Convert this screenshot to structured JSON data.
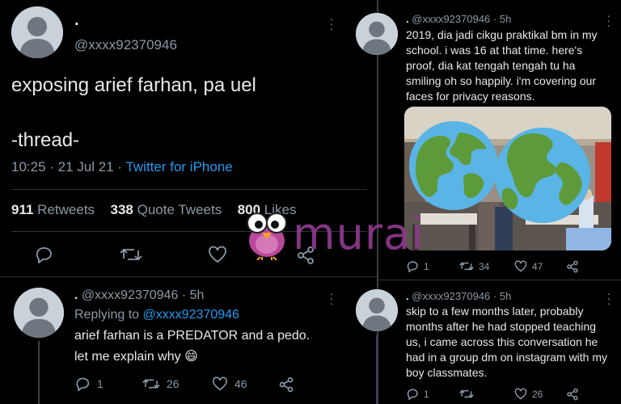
{
  "main_tweet": {
    "display_name": ".",
    "handle": "@xxxx92370946",
    "text_line1": "exposing arief farhan, pa uel",
    "text_line2": "-thread-",
    "time": "10:25 · 21 Jul 21 · ",
    "client": "Twitter for iPhone",
    "retweets_count": "911",
    "retweets_label": "Retweets",
    "quotes_count": "338",
    "quotes_label": "Quote Tweets",
    "likes_count": "800",
    "likes_label": "Likes"
  },
  "reply_tweet": {
    "display_name": ".",
    "handle": "@xxxx92370946",
    "age": "· 5h",
    "replying_prefix": "Replying to ",
    "replying_handle": "@xxxx92370946",
    "line1": "arief farhan is a PREDATOR and a pedo.",
    "line2": "let me explain why 😄",
    "replies": "1",
    "retweets": "26",
    "likes": "46"
  },
  "right_tweet_1": {
    "display_name": ".",
    "handle": "@xxxx92370946",
    "age": "· 5h",
    "line1": "2019, dia jadi cikgu praktikal bm in my",
    "line2": "school. i was 16 at that time. here's",
    "line3": "proof, dia kat tengah tengah tu ha",
    "line4": "smiling oh so happily. i'm covering our",
    "line5": "faces for privacy reasons.",
    "replies": "1",
    "retweets": "34",
    "likes": "47"
  },
  "right_tweet_2": {
    "display_name": ".",
    "handle": "@xxxx92370946",
    "age": "· 5h",
    "line1": "skip to a few months later, probably",
    "line2": "months after he had stopped teaching",
    "line3": "us, i came across this conversation he",
    "line4": "had in a group dm on instagram with my",
    "line5": "boy classmates.",
    "replies": "1",
    "likes": "26"
  },
  "watermark": {
    "brand": "murai",
    "color": "#8e3a8f"
  },
  "colors": {
    "background": "#000000",
    "link_blue": "#1d9bf0",
    "secondary_gray": "#8b98a5"
  },
  "icons": [
    "reply-icon",
    "retweet-icon",
    "like-icon",
    "share-icon",
    "more-icon",
    "bird-mascot-icon",
    "earth-icon"
  ]
}
